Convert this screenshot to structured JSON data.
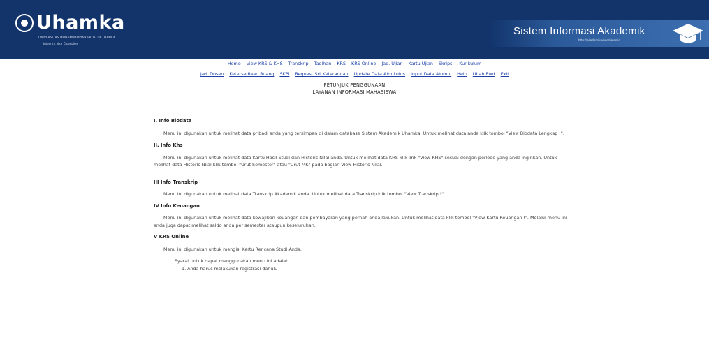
{
  "header": {
    "logo_text": "Uhamka",
    "logo_subtitle": "UNIVERSITAS MUHAMMADIYAH PROF. DR. HAMKA",
    "logo_tagline": "Integrity. Your Champion",
    "system_title": "Sistem Informasi Akademik",
    "system_url": "http://akademik.uhamka.ac.id"
  },
  "nav": {
    "row1": [
      "Home",
      "View KRS & KHS",
      "Transkrip",
      "Tagihan",
      "KRS",
      "KRS Online",
      "Jad. Ujian",
      "Kartu Ujian",
      "Skripsi",
      "Kurikulum"
    ],
    "row2": [
      "Jad. Dosen",
      "Ketersediaan Ruang",
      "SKPI",
      "Request Srt Keterangan",
      "Update Data Alm Lulus",
      "Input Data Alumni",
      "Help",
      "Ubah Pwd",
      "Exit"
    ]
  },
  "page": {
    "title_line1": "PETUNJUK PENGGUNAAN",
    "title_line2": "LAYANAN INFORMASI MAHASISWA"
  },
  "sections": {
    "biodata": {
      "title": "I. Info Biodata",
      "text": "Menu ini digunakan untuk melihat data pribadi anda yang tersimpan di dalam database Sistem Akademik Uhamka. Untuk melihat data anda klik tombol \"View Biodata Lengkap !\"."
    },
    "khs": {
      "title": "II. Info Khs",
      "text": "Menu ini digunakan untuk melihat data Kartu Hasil Studi dan Historis Nilai anda. Untuk melihat data KHS klik link \"View KHS\" sesuai dengan periode yang anda inginkan. Untuk melihat data Historis Nilai klik tombol \"Urut Semester\" atau \"Urut MK\" pada bagian View Historis Nilai."
    },
    "transkrip": {
      "title": "III Info Transkrip",
      "text": "Menu ini digunakan untuk melihat data Transkrip Akademik anda. Untuk melihat data Transkrip klik tombol \"View Transkrip !\"."
    },
    "keuangan": {
      "title": "IV Info Keuangan",
      "text": "Menu ini digunakan untuk melihat data kewajiban keuangan dan pembayaran yang pernah anda lakukan. Untuk melihat data klik tombol \"View Kartu Keuangan !\". Melalui menu ini anda juga dapat melihat saldo anda per semester ataupun keseluruhan."
    },
    "krs": {
      "title": "V KRS Online",
      "text": "Menu ini digunakan untuk mengisi Kartu Rencana Studi Anda.",
      "req_intro": "Syarat untuk dapat menggunakan menu ini adalah :",
      "req1": "1. Anda harus melakukan registrasi dahulu"
    }
  }
}
